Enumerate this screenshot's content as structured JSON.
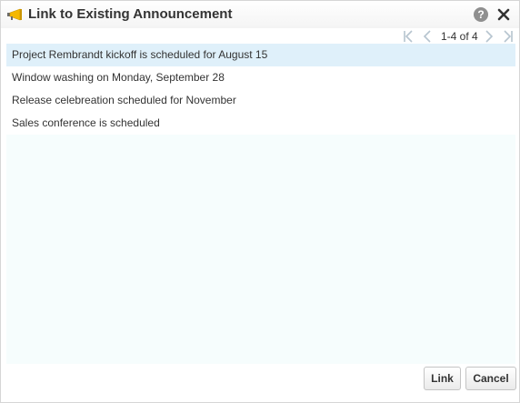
{
  "dialog": {
    "title": "Link to Existing Announcement",
    "title_icon": "megaphone-icon",
    "help_label": "?",
    "close_icon": "close-icon"
  },
  "pager": {
    "count_text": "1-4 of 4",
    "first_icon": "first-page-icon",
    "prev_icon": "previous-page-icon",
    "next_icon": "next-page-icon",
    "last_icon": "last-page-icon"
  },
  "announcements": [
    {
      "label": "Project Rembrandt kickoff is scheduled for August 15",
      "selected": true
    },
    {
      "label": "Window washing on Monday, September 28",
      "selected": false
    },
    {
      "label": "Release celebreation scheduled for November",
      "selected": false
    },
    {
      "label": "Sales conference is scheduled",
      "selected": false
    }
  ],
  "buttons": {
    "link_label": "Link",
    "cancel_label": "Cancel"
  },
  "colors": {
    "selected_row": "#dff0fa",
    "list_background": "#f6fdfd",
    "icon_accent": "#f5b800"
  }
}
